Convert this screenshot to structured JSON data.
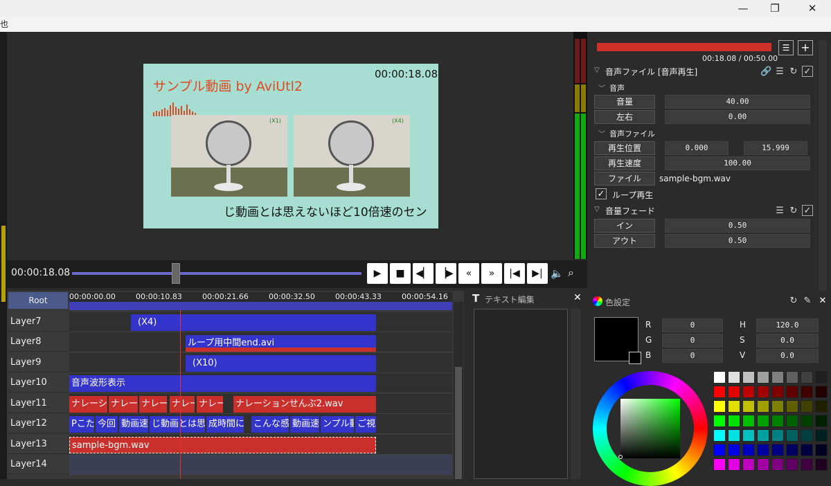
{
  "window": {
    "minimize": "—",
    "maximize": "❐",
    "close": "✕"
  },
  "menu": {
    "partial": "也"
  },
  "preview": {
    "title": "サンプル動画 by AviUtl2",
    "timecode": "00:00:18.08",
    "label_left": "(X1)",
    "label_right": "(X4)",
    "subtitle": "じ動画とは思えないほど10倍速のセン"
  },
  "transport": {
    "time": "00:00:18.08",
    "buttons": [
      "play",
      "stop",
      "prev-frame",
      "next-frame",
      "rewind",
      "fast-forward",
      "to-start",
      "to-end"
    ],
    "seek_fraction": 0.36
  },
  "timeline": {
    "root_label": "Root",
    "ticks": [
      "00:00:00.00",
      "00:00:10.83",
      "00:00:21.66",
      "00:00:32.50",
      "00:00:43.33",
      "00:00:54.16"
    ],
    "layers": [
      "Layer7",
      "Layer8",
      "Layer9",
      "Layer10",
      "Layer11",
      "Layer12",
      "Layer13",
      "Layer14"
    ],
    "clips": {
      "l7": "(X4)",
      "l8": "ループ用中間end.avi",
      "l9": "(X10)",
      "l10": "音声波形表示",
      "l11": [
        "ナレーショ",
        "ナレーシ",
        "ナレー:",
        "ナレー",
        "ナレー:",
        "ナレーションせんぶ2.wav"
      ],
      "l12": [
        "Pこた",
        "今回",
        "動画速",
        "じ動画とは思",
        "成時間に",
        "こんな感",
        "動画速",
        "ンプル動",
        "ご視耶"
      ],
      "l13": "sample-bgm.wav"
    }
  },
  "text_panel": {
    "title": "テキスト編集",
    "icon": "T"
  },
  "properties": {
    "time_display": "00:18.08 / 00:50.00",
    "object_title": "音声ファイル [音声再生]",
    "section_audio": "音声",
    "volume_label": "音量",
    "volume_value": "40.00",
    "pan_label": "左右",
    "pan_value": "0.00",
    "section_file": "音声ファイル",
    "pos_label": "再生位置",
    "pos_value1": "0.000",
    "pos_value2": "15.999",
    "speed_label": "再生速度",
    "speed_value": "100.00",
    "file_label": "ファイル",
    "file_value": "sample-bgm.wav",
    "loop_label": "ループ再生",
    "fade_title": "音量フェード",
    "fadein_label": "イン",
    "fadein_value": "0.50",
    "fadeout_label": "アウト",
    "fadeout_value": "0.50"
  },
  "color": {
    "title": "色設定",
    "r_label": "R",
    "r_value": "0",
    "g_label": "G",
    "g_value": "0",
    "b_label": "B",
    "b_value": "0",
    "h_label": "H",
    "h_value": "120.0",
    "s_label": "S",
    "s_value": "0.0",
    "v_label": "V",
    "v_value": "0.0",
    "swatch_rows": [
      [
        "#ffffff",
        "#e0e0e0",
        "#c0c0c0",
        "#a0a0a0",
        "#808080",
        "#606060",
        "#404040",
        "#202020"
      ],
      [
        "#ff0000",
        "#e00000",
        "#c00000",
        "#a00000",
        "#800000",
        "#600000",
        "#400000",
        "#200000"
      ],
      [
        "#ffff00",
        "#e0e000",
        "#c0c000",
        "#a0a000",
        "#808000",
        "#606000",
        "#404000",
        "#202000"
      ],
      [
        "#00ff00",
        "#00e000",
        "#00c000",
        "#00a000",
        "#008000",
        "#006000",
        "#004000",
        "#002000"
      ],
      [
        "#00ffff",
        "#00e0e0",
        "#00c0c0",
        "#00a0a0",
        "#008080",
        "#006060",
        "#004040",
        "#002020"
      ],
      [
        "#0000ff",
        "#0000e0",
        "#0000c0",
        "#0000a0",
        "#000080",
        "#000060",
        "#000040",
        "#000020"
      ],
      [
        "#ff00ff",
        "#e000e0",
        "#c000c0",
        "#a000a0",
        "#800080",
        "#600060",
        "#400040",
        "#200020"
      ]
    ]
  }
}
